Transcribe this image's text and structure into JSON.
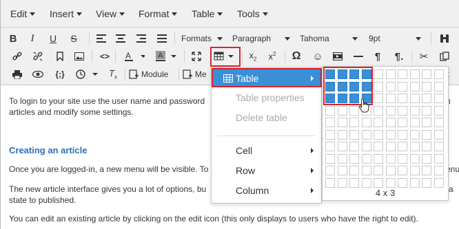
{
  "menubar": {
    "items": [
      "Edit",
      "Insert",
      "View",
      "Format",
      "Table",
      "Tools"
    ]
  },
  "toolbar": {
    "formats_label": "Formats",
    "block_format": "Paragraph",
    "font_family": "Tahoma",
    "font_size": "9pt",
    "module_label": "Module",
    "me_label": "Me"
  },
  "content": {
    "p1_line1": "To login to your site use the user name and password",
    "p1_line1_end": "ed-in",
    "p1_line2": "articles and modify some settings.",
    "heading": "Creating an article",
    "p2_line1": "Once you are logged-in, a new menu will be visible. To",
    "p2_line1_end": "menu",
    "p3_line1": "The new article interface gives you a lot of options, bu",
    "p3_line1_end": "ent a",
    "p3_line2": "state to published.",
    "p4_line1": "You can edit an existing article by clicking on the edit icon (this only displays to users who have the right to edit)."
  },
  "table_menu": {
    "table": "Table",
    "table_properties": "Table properties",
    "delete_table": "Delete table",
    "cell": "Cell",
    "row": "Row",
    "column": "Column"
  },
  "grid_picker": {
    "columns": 10,
    "rows": 10,
    "selected_cols": 4,
    "selected_rows": 3,
    "label": "4 x 3"
  },
  "colors": {
    "accent": "#3a8fd6",
    "highlight": "#d9232e",
    "heading": "#2a6fb5"
  }
}
